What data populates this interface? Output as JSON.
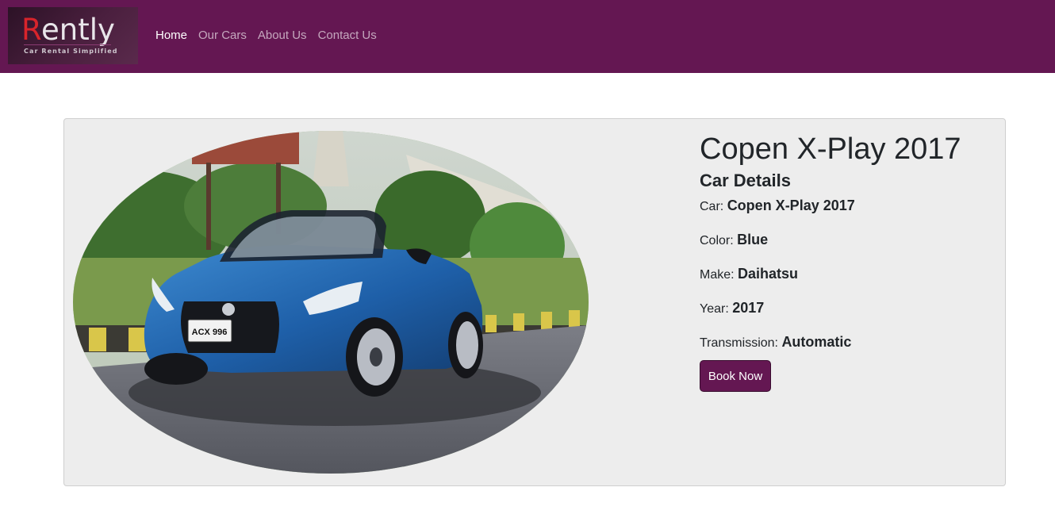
{
  "brand": {
    "logo_letter": "R",
    "logo_rest": "ently",
    "tagline": "Car Rental Simplified"
  },
  "nav": {
    "items": [
      {
        "label": "Home",
        "active": true
      },
      {
        "label": "Our Cars",
        "active": false
      },
      {
        "label": "About Us",
        "active": false
      },
      {
        "label": "Contact Us",
        "active": false
      }
    ]
  },
  "car": {
    "title": "Copen X-Play 2017",
    "section_title": "Car Details",
    "specs": [
      {
        "label": "Car:",
        "value": "Copen X-Play 2017"
      },
      {
        "label": "Color:",
        "value": "Blue"
      },
      {
        "label": "Make:",
        "value": "Daihatsu"
      },
      {
        "label": "Year:",
        "value": "2017"
      },
      {
        "label": "Transmission:",
        "value": "Automatic"
      }
    ],
    "plate": "ACX 996",
    "book_label": "Book Now"
  },
  "colors": {
    "navbar": "#641752",
    "button": "#641752",
    "logo_accent": "#d8242b",
    "card_bg": "#ededed"
  }
}
